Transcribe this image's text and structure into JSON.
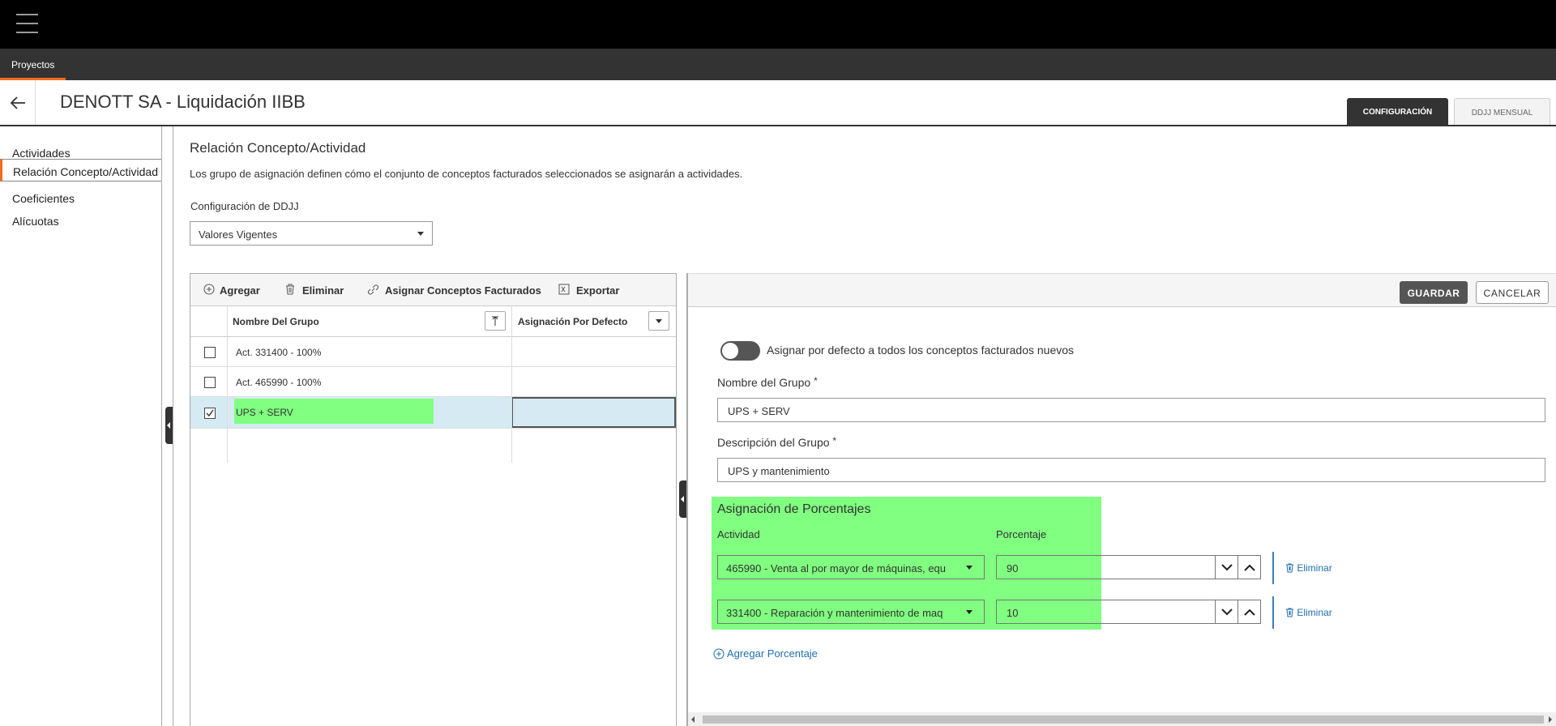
{
  "navbar": {
    "tab": "Proyectos"
  },
  "header": {
    "title": "DENOTT SA - Liquidación IIBB",
    "tabs": [
      "CONFIGURACIÓN",
      "DDJJ MENSUAL"
    ]
  },
  "sidebar": {
    "items": [
      "Actividades",
      "Relación Concepto/Actividad",
      "Coeficientes",
      "Alícuotas"
    ],
    "active": "Relación Concepto/Actividad"
  },
  "section": {
    "title": "Relación Concepto/Actividad",
    "description": "Los grupo de asignación definen cómo el conjunto de conceptos facturados seleccionados se asignarán a actividades.",
    "config_label": "Configuración de DDJJ",
    "config_value": "Valores Vigentes"
  },
  "grid": {
    "toolbar": {
      "add": "Agregar",
      "delete": "Eliminar",
      "assign": "Asignar Conceptos Facturados",
      "export": "Exportar"
    },
    "columns": [
      "Nombre Del Grupo",
      "Asignación Por Defecto"
    ],
    "rows": [
      {
        "name": "Act. 331400 - 100%",
        "default": "",
        "checked": false
      },
      {
        "name": "Act. 465990 - 100%",
        "default": "",
        "checked": false
      },
      {
        "name": "UPS + SERV",
        "default": "",
        "checked": true
      }
    ]
  },
  "detail": {
    "save": "GUARDAR",
    "cancel": "CANCELAR",
    "toggle_label": "Asignar por defecto a todos los conceptos facturados nuevos",
    "group_name_label": "Nombre del Grupo",
    "group_name_value": "UPS + SERV",
    "group_desc_label": "Descripción del Grupo",
    "group_desc_value": "UPS y mantenimiento",
    "required_mark": "*",
    "pct_title": "Asignación de Porcentajes",
    "col_activity": "Actividad",
    "col_percent": "Porcentaje",
    "assignments": [
      {
        "activity": "465990 - Venta al por mayor de máquinas, equ",
        "percent": "90",
        "delete": "Eliminar"
      },
      {
        "activity": "331400 - Reparación y mantenimiento de maq",
        "percent": "10",
        "delete": "Eliminar"
      }
    ],
    "add_pct": "Agregar Porcentaje"
  },
  "colors": {
    "accent": "#f26b1d",
    "highlight": "#80ff80",
    "selected_row": "#d6eaf3",
    "link": "#1f6fae"
  }
}
